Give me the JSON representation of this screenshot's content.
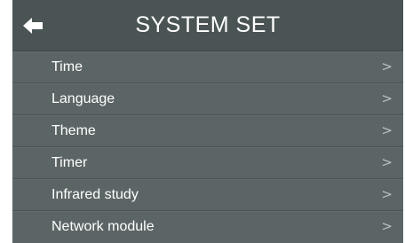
{
  "header": {
    "title": "SYSTEM SET",
    "back_icon": "arrow-left-icon"
  },
  "menu": {
    "chevron": ">",
    "items": [
      {
        "label": "Time"
      },
      {
        "label": "Language"
      },
      {
        "label": "Theme"
      },
      {
        "label": "Timer"
      },
      {
        "label": "Infrared study"
      },
      {
        "label": "Network module"
      }
    ]
  },
  "colors": {
    "background": "#5c6566",
    "header_background": "#4b5455",
    "text": "#ffffff",
    "chevron": "#b8c0c1"
  }
}
